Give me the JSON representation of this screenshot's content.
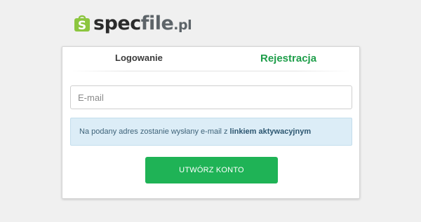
{
  "logo": {
    "part_a": "spec",
    "part_b": "file",
    "part_c": ".pl",
    "badge_icon": "s-shopping-bag-icon",
    "badge_color": "#8cc63f"
  },
  "tabs": {
    "login_label": "Logowanie",
    "register_label": "Rejestracja",
    "active": "register",
    "active_color": "#1e9e4a"
  },
  "form": {
    "email_placeholder": "E-mail",
    "email_value": "",
    "info_text": "Na podany adres zostanie wysłany e-mail z",
    "info_strong": "linkiem aktywacyjnym",
    "submit_label": "UTWÓRZ KONTO",
    "submit_color": "#1fb356"
  }
}
